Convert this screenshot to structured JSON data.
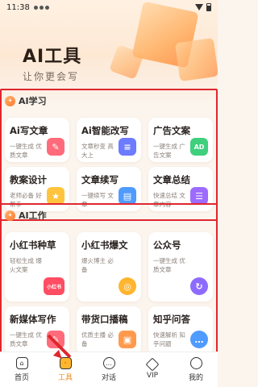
{
  "status": {
    "time": "11:38"
  },
  "hero": {
    "title": "AI工具",
    "subtitle": "让你更会写"
  },
  "section1": {
    "title": "AI学习",
    "cards": [
      {
        "title": "Ai写文章",
        "desc": "一键生成 优质文章",
        "icon": "pen-icon",
        "color": "#ff6b7a"
      },
      {
        "title": "Ai智能改写",
        "desc": "文章秒变 高大上",
        "icon": "document-icon",
        "color": "#6c7bff"
      },
      {
        "title": "广告文案",
        "desc": "一键生成 广告文案",
        "icon": "ad-icon",
        "color": "#3fcf7d",
        "icon_text": "AD"
      },
      {
        "title": "教案设计",
        "desc": "老师必备 好帮手",
        "icon": "star-icon",
        "color": "#ffc43d"
      },
      {
        "title": "文章续写",
        "desc": "一键续写 文章",
        "icon": "document-icon",
        "color": "#4f9bff"
      },
      {
        "title": "文章总结",
        "desc": "快速总结 文章内容",
        "icon": "list-icon",
        "color": "#9d6bff"
      }
    ]
  },
  "section2": {
    "title": "AI工作",
    "cards": [
      {
        "title": "小红书种草",
        "desc": "轻松生成 爆火文案",
        "icon": "xiaohongshu-icon",
        "color": "#ff4d63",
        "icon_text": "小红书"
      },
      {
        "title": "小红书爆文",
        "desc": "爆火博主 必备",
        "icon": "coin-icon",
        "color": "#ffb52e"
      },
      {
        "title": "公众号",
        "desc": "一键生成 优质文章",
        "icon": "swirl-icon",
        "color": "#8e6bff"
      },
      {
        "title": "新媒体写作",
        "desc": "一键生成 优质文章",
        "icon": "pen-icon",
        "color": "#ff6b7a"
      },
      {
        "title": "带货口播稿",
        "desc": "优质主播 必备",
        "icon": "gift-icon",
        "color": "#ff9a4d"
      },
      {
        "title": "知乎问答",
        "desc": "快速解析 知乎问题",
        "icon": "chat-icon",
        "color": "#4f9bff"
      }
    ]
  },
  "tabs": [
    {
      "label": "首页",
      "icon": "home-icon"
    },
    {
      "label": "工具",
      "icon": "toolbox-icon",
      "active": true
    },
    {
      "label": "对话",
      "icon": "chat-icon"
    },
    {
      "label": "VIP",
      "icon": "diamond-icon"
    },
    {
      "label": "我的",
      "icon": "user-icon"
    }
  ]
}
